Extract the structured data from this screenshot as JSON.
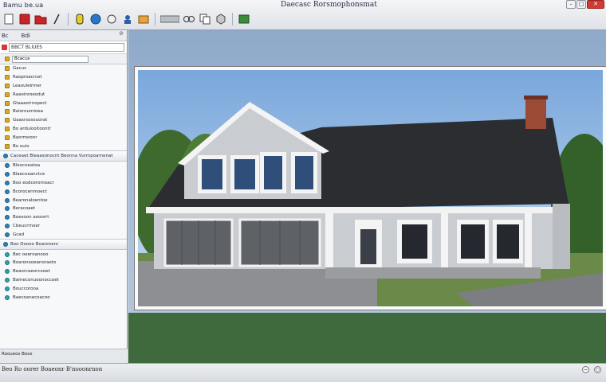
{
  "app": {
    "name": "Bamu be.ua",
    "window_title": "Daecasc Rorsmophonsmat"
  },
  "colors": {
    "accent": "#2f80b5",
    "folder": "#d8a924",
    "close": "#d23b34",
    "grass": "#3e6a3d",
    "roof": "#2b2d31",
    "siding": "#c9ccd1"
  },
  "toolbar": {
    "icons": [
      "new-file-icon",
      "red-save-icon",
      "red-open-icon",
      "pencil-icon",
      "info-icon",
      "globe-icon",
      "camera-icon",
      "person-icon",
      "render-icon",
      "bar-tool-icon",
      "link-icon",
      "copy-icon",
      "cube-icon",
      "export-icon"
    ]
  },
  "left": {
    "menu": [
      "Bc",
      "Bdi"
    ],
    "search_value": "BBCT BLIUES",
    "filter_value": "Bcacus",
    "tree_top": [
      "Gacus",
      "Raoproacrcet",
      "Leaouleirmer",
      "Raaoinroeodut",
      "Gtaaaoirnopect",
      "Baioroumioea",
      "Gaasrsosouorat",
      "Bo arduiooitoontr",
      "Baormoonr",
      "Bo ouio"
    ],
    "section1_label": "Caceaet Bleaasonocnt Beonna Vurmpoarnenat",
    "tree_mid": [
      "Bleocoeatoa",
      "Blaecoaanctce",
      "Boo eodceromoacr",
      "Bcorocenmoect",
      "Bearonaloentoe",
      "Beracoaet",
      "Boesoon aooorrt",
      "Cbeucrrnoer",
      "Gcad"
    ],
    "section2_label": "Boo Doooo Boaronenr",
    "tree_bottom": [
      "Bec oeeroanooo",
      "Boaronooeanoraeto",
      "Beaorcaeorcooet",
      "Bameconuoonoccoet",
      "Bouccorooa",
      "Baecoanecoacoo"
    ],
    "status_text": "Rooueos Boos"
  },
  "status": {
    "left_text": "Beo Ro oorer Boaeonr B'nooonrnon",
    "right_icons": [
      "zoom-out-icon",
      "fit-icon"
    ]
  }
}
